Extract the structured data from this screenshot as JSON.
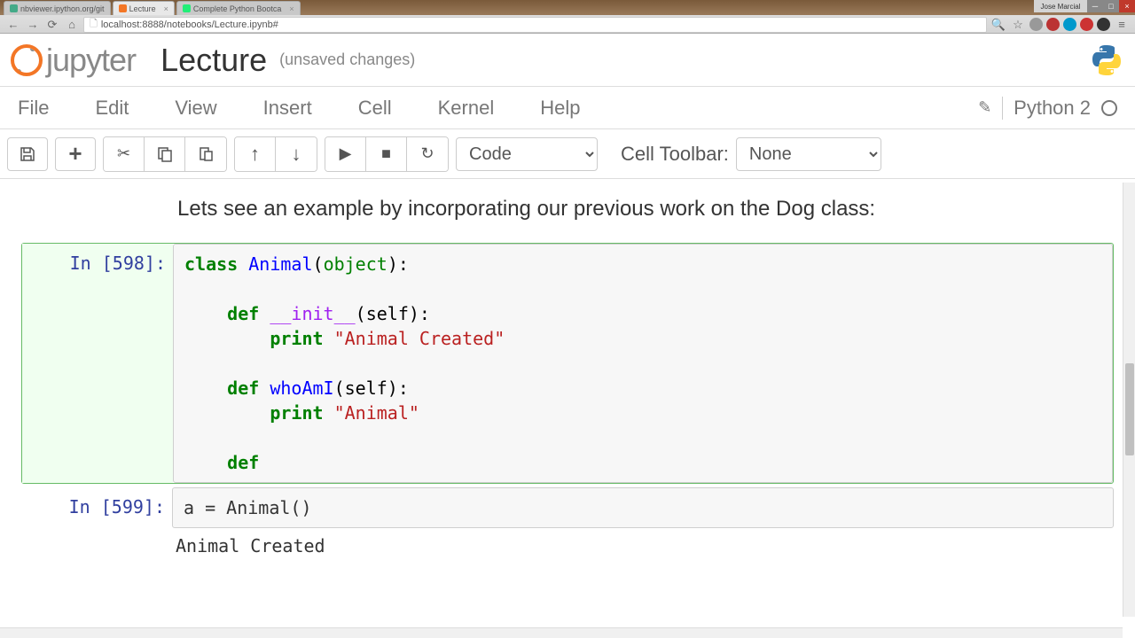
{
  "browser": {
    "tabs": [
      {
        "label": "nbviewer.ipython.org/git"
      },
      {
        "label": "Lecture"
      },
      {
        "label": "Complete Python Bootca"
      }
    ],
    "url": "localhost:8888/notebooks/Lecture.ipynb#",
    "user": "Jose Marcial"
  },
  "header": {
    "logo_text": "jupyter",
    "title": "Lecture",
    "save_status": "(unsaved changes)"
  },
  "menubar": {
    "items": [
      "File",
      "Edit",
      "View",
      "Insert",
      "Cell",
      "Kernel",
      "Help"
    ],
    "kernel": "Python 2"
  },
  "toolbar": {
    "cell_type": "Code",
    "cell_toolbar_label": "Cell Toolbar:",
    "cell_toolbar_value": "None"
  },
  "notebook": {
    "markdown": "Lets see an example by incorporating our previous work on the Dog class:",
    "cells": [
      {
        "prompt": "In [598]:",
        "code_tokens": [
          {
            "t": "class",
            "c": "kw-class"
          },
          {
            "t": " "
          },
          {
            "t": "Animal",
            "c": "clsname"
          },
          {
            "t": "(",
            "c": "paren"
          },
          {
            "t": "object",
            "c": "builtin"
          },
          {
            "t": "):",
            "c": "paren"
          },
          {
            "t": "\n\n    "
          },
          {
            "t": "def",
            "c": "kw-def"
          },
          {
            "t": " "
          },
          {
            "t": "__init__",
            "c": "dunder"
          },
          {
            "t": "(self):",
            "c": "paren"
          },
          {
            "t": "\n        "
          },
          {
            "t": "print",
            "c": "kw-print"
          },
          {
            "t": " "
          },
          {
            "t": "\"Animal Created\"",
            "c": "string"
          },
          {
            "t": "\n\n    "
          },
          {
            "t": "def",
            "c": "kw-def"
          },
          {
            "t": " "
          },
          {
            "t": "whoAmI",
            "c": "fnname"
          },
          {
            "t": "(self):",
            "c": "paren"
          },
          {
            "t": "\n        "
          },
          {
            "t": "print",
            "c": "kw-print"
          },
          {
            "t": " "
          },
          {
            "t": "\"Animal\"",
            "c": "string"
          },
          {
            "t": "\n\n    "
          },
          {
            "t": "def",
            "c": "kw-def"
          }
        ],
        "selected": true
      },
      {
        "prompt": "In [599]:",
        "code_tokens": [
          {
            "t": "a "
          },
          {
            "t": "="
          },
          {
            "t": " Animal()"
          }
        ],
        "output": "Animal Created",
        "selected": false
      }
    ]
  }
}
